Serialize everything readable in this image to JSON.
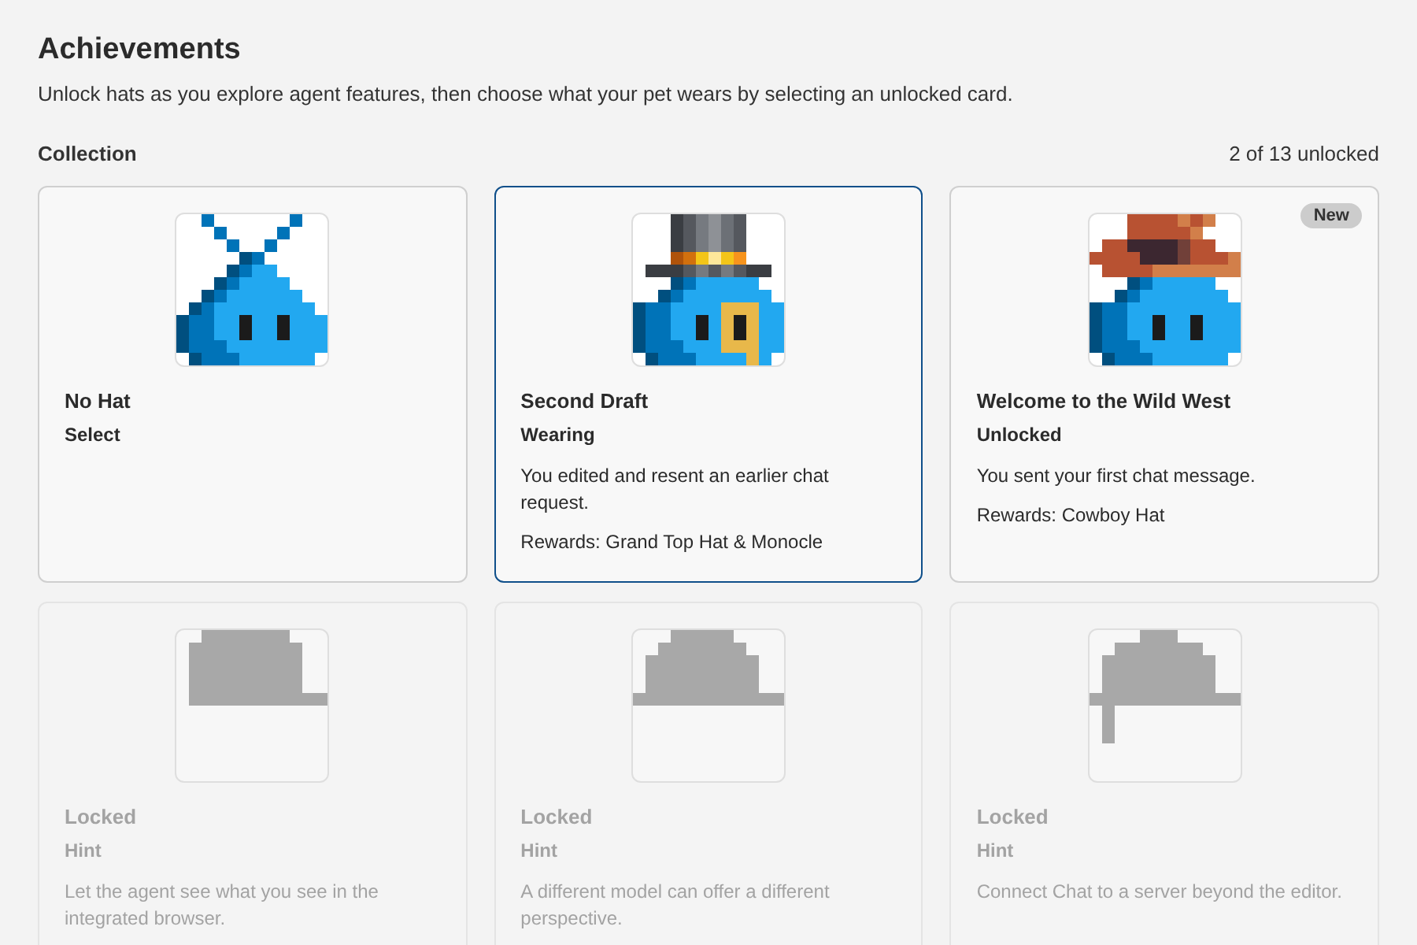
{
  "header": {
    "title": "Achievements",
    "subtitle": "Unlock hats as you explore agent features, then choose what your pet wears by selecting an unlocked card."
  },
  "collection": {
    "label": "Collection",
    "count": "2 of 13 unlocked"
  },
  "cards": [
    {
      "kind": "antenna",
      "title": "No Hat",
      "status": "Select",
      "selected": false,
      "locked": false
    },
    {
      "kind": "top-hat",
      "title": "Second Draft",
      "status": "Wearing",
      "selected": true,
      "locked": false,
      "description": "You edited and resent an earlier chat request.",
      "rewards": "Rewards: Grand Top Hat & Monocle"
    },
    {
      "kind": "cowboy",
      "title": "Welcome to the Wild West",
      "status": "Unlocked",
      "selected": false,
      "locked": false,
      "badge": "New",
      "description": "You sent your first chat message.",
      "rewards": "Rewards: Cowboy Hat"
    },
    {
      "kind": "cap",
      "title": "Locked",
      "status": "Hint",
      "selected": false,
      "locked": true,
      "description": "Let the agent see what you see in the integrated browser."
    },
    {
      "kind": "dome",
      "title": "Locked",
      "status": "Hint",
      "selected": false,
      "locked": true,
      "description": "A different model can offer a different perspective."
    },
    {
      "kind": "umbrella",
      "title": "Locked",
      "status": "Hint",
      "selected": false,
      "locked": true,
      "description": "Connect Chat to a server beyond the editor."
    }
  ]
}
